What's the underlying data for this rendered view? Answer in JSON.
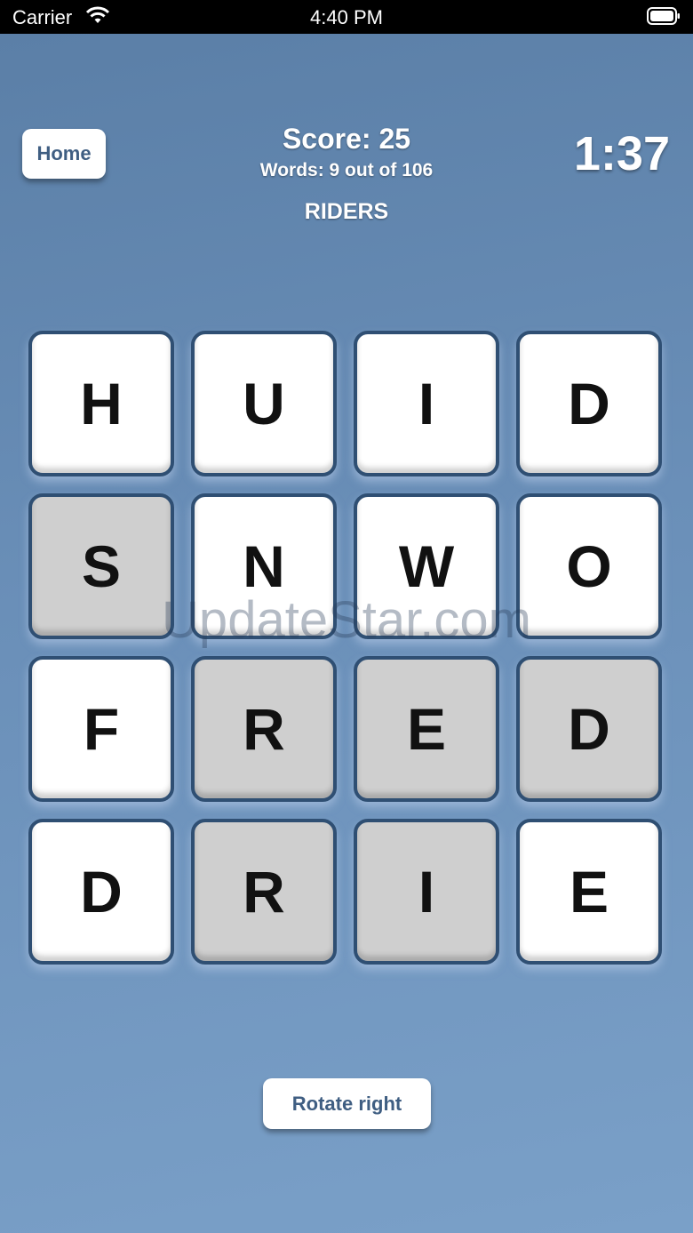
{
  "status_bar": {
    "carrier": "Carrier",
    "time": "4:40 PM",
    "wifi_icon": "wifi-icon",
    "battery_icon": "battery-icon"
  },
  "header": {
    "home_label": "Home",
    "score_text": "Score: 25",
    "words_text": "Words: 9 out of 106",
    "current_word": "RIDERS",
    "timer": "1:37"
  },
  "board": {
    "tiles": [
      {
        "letter": "H",
        "selected": false
      },
      {
        "letter": "U",
        "selected": false
      },
      {
        "letter": "I",
        "selected": false
      },
      {
        "letter": "D",
        "selected": false
      },
      {
        "letter": "S",
        "selected": true
      },
      {
        "letter": "N",
        "selected": false
      },
      {
        "letter": "W",
        "selected": false
      },
      {
        "letter": "O",
        "selected": false
      },
      {
        "letter": "F",
        "selected": false
      },
      {
        "letter": "R",
        "selected": true
      },
      {
        "letter": "E",
        "selected": true
      },
      {
        "letter": "D",
        "selected": true
      },
      {
        "letter": "D",
        "selected": false
      },
      {
        "letter": "R",
        "selected": true
      },
      {
        "letter": "I",
        "selected": true
      },
      {
        "letter": "E",
        "selected": false
      }
    ]
  },
  "watermark": "UpdateStar.com",
  "footer": {
    "rotate_label": "Rotate right"
  },
  "colors": {
    "background": "#6a8fb8",
    "tile_selected": "#cfcfcf",
    "tile_border": "#2f4f73",
    "button_text": "#3f5e82"
  }
}
